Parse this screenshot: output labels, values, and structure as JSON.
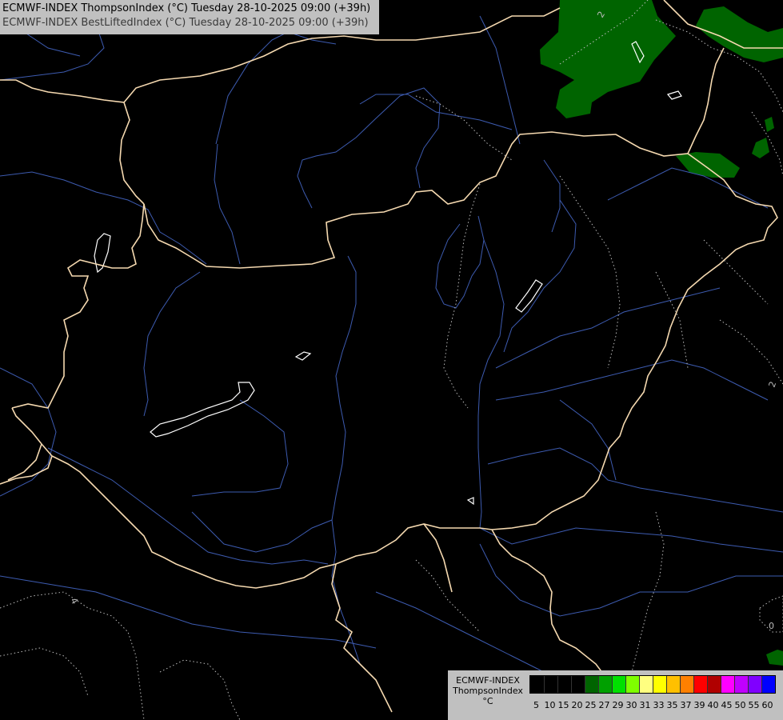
{
  "header": {
    "line1": "ECMWF-INDEX ThompsonIndex (°C) Tuesday 28-10-2025 09:00 (+39h)",
    "line2": "ECMWF-INDEX BestLiftedIndex (°C) Tuesday 28-10-2025 09:00 (+39h)"
  },
  "legend": {
    "title_lines": [
      "ECMWF-INDEX",
      "ThompsonIndex",
      "°C"
    ],
    "ticks": [
      "5",
      "10",
      "15",
      "20",
      "25",
      "27",
      "29",
      "30",
      "31",
      "33",
      "35",
      "37",
      "39",
      "40",
      "45",
      "50",
      "55",
      "60"
    ],
    "colors": [
      "#000000",
      "#000000",
      "#000000",
      "#000000",
      "#006400",
      "#00a000",
      "#00e000",
      "#7fff00",
      "#ffff80",
      "#ffff00",
      "#ffc000",
      "#ff8000",
      "#ff0000",
      "#b00000",
      "#ff00ff",
      "#c000ff",
      "#8000ff",
      "#0000ff"
    ]
  },
  "contour_labels": [
    "2",
    "2",
    "4",
    "0"
  ],
  "map_colors": {
    "background": "#000000",
    "borders": "#f5d9b0",
    "rivers": "#3d5bb0",
    "lakes": "#ffffff",
    "contours": "#bcbcbc",
    "fill_green": "#006400"
  }
}
